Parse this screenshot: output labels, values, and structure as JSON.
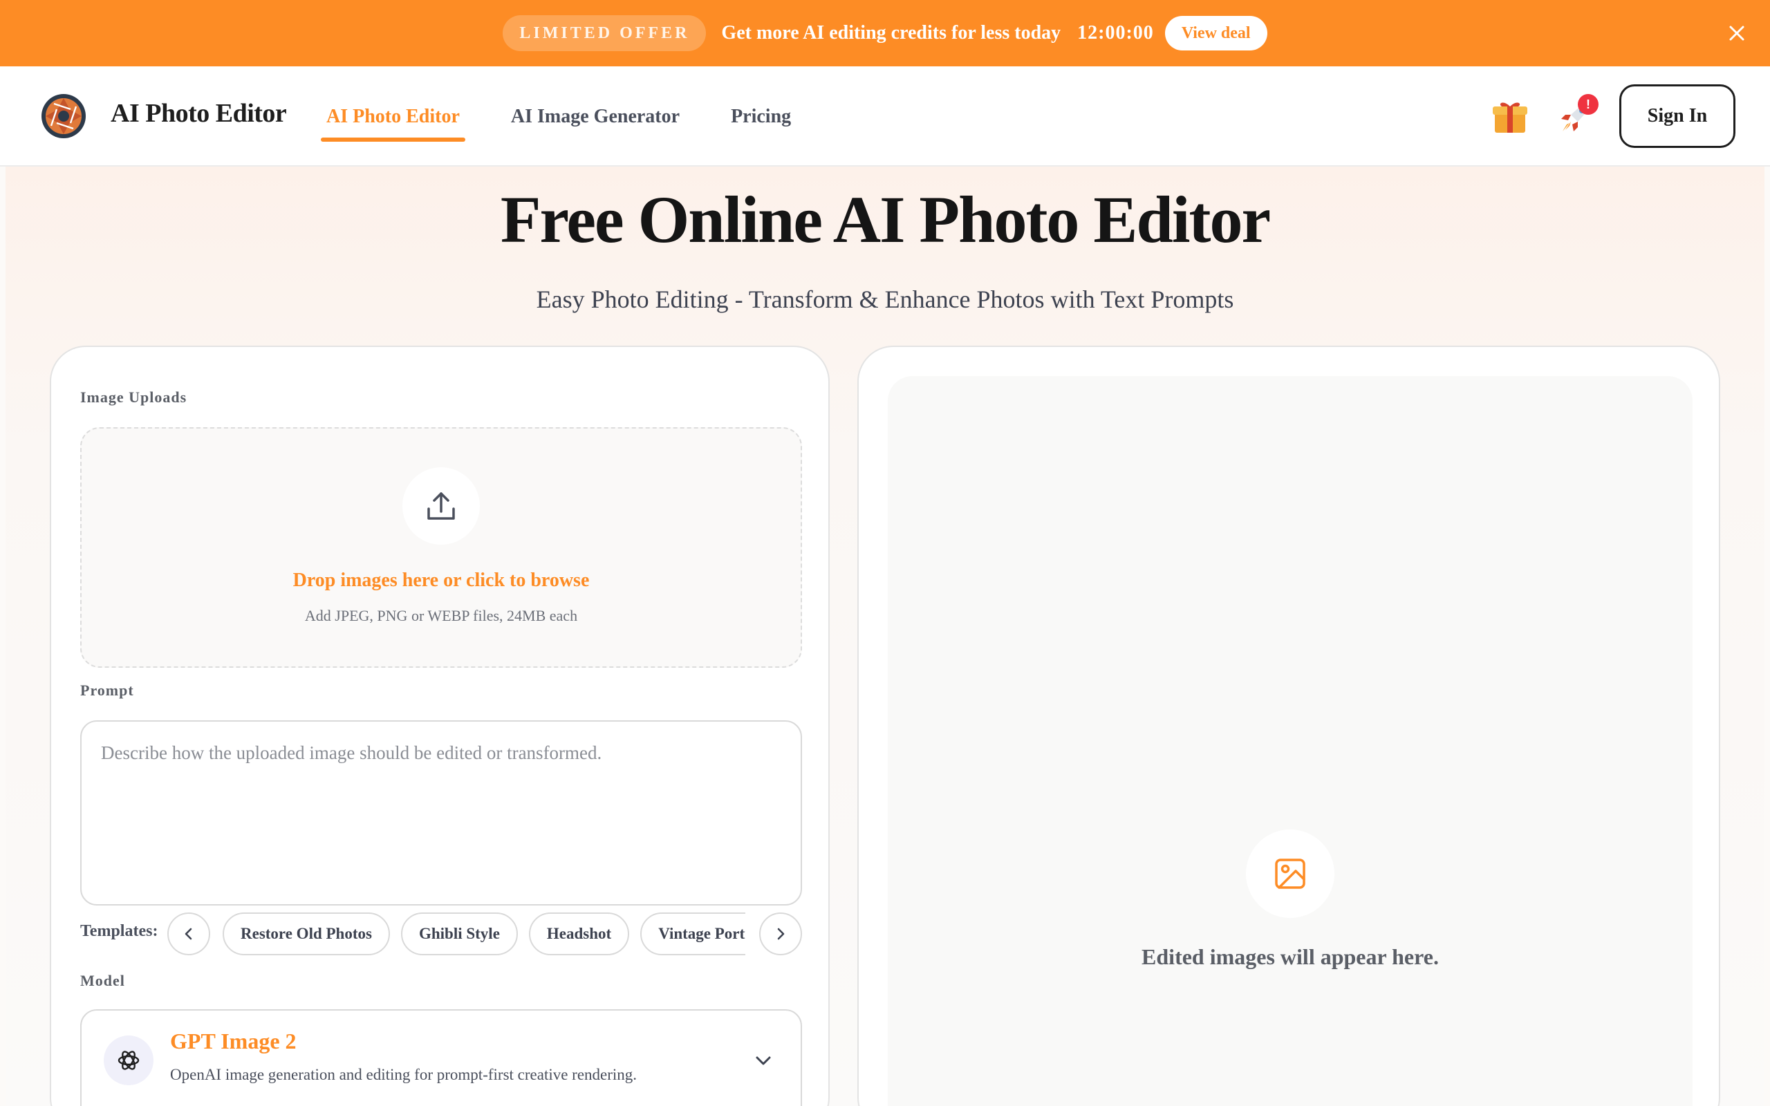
{
  "promo": {
    "badge": "LIMITED OFFER",
    "text": "Get more AI editing credits for less today",
    "timer": "12:00:00",
    "cta": "View deal"
  },
  "header": {
    "brand": "AI Photo Editor",
    "nav": [
      {
        "label": "AI Photo Editor",
        "active": true
      },
      {
        "label": "AI Image Generator",
        "active": false
      },
      {
        "label": "Pricing",
        "active": false
      }
    ],
    "notification_badge": "!",
    "sign_in": "Sign In"
  },
  "hero": {
    "title": "Free Online AI Photo Editor",
    "subtitle": "Easy Photo Editing - Transform & Enhance Photos with Text Prompts"
  },
  "editor": {
    "uploads_label": "Image Uploads",
    "drop_title": "Drop images here or click to browse",
    "drop_hint": "Add JPEG, PNG or WEBP files, 24MB each",
    "prompt_label": "Prompt",
    "prompt_placeholder": "Describe how the uploaded image should be edited or transformed.",
    "prompt_value": "",
    "templates_label": "Templates:",
    "templates": [
      "Restore Old Photos",
      "Ghibli Style",
      "Headshot",
      "Vintage Portrait"
    ],
    "model_label": "Model",
    "model": {
      "name": "GPT Image 2",
      "description": "OpenAI image generation and editing for prompt-first creative rendering."
    }
  },
  "output": {
    "empty_text": "Edited images will appear here."
  },
  "colors": {
    "accent": "#fd8c25",
    "notification": "#ef3340",
    "text_dark": "#1e1e1e"
  },
  "icons": {
    "close": "close-icon",
    "logo": "aperture-logo-icon",
    "gift": "gift-icon",
    "rocket": "rocket-icon",
    "upload": "upload-icon",
    "prev": "chevron-left-icon",
    "next": "chevron-right-icon",
    "model": "openai-icon",
    "dropdown": "chevron-down-icon",
    "image": "image-icon"
  }
}
